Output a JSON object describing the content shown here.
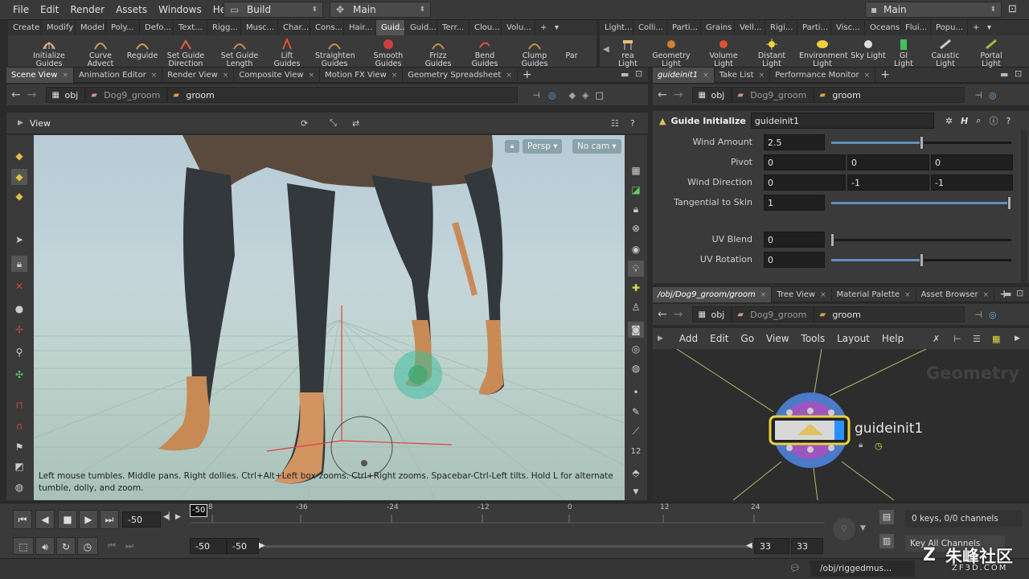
{
  "menubar": {
    "items": [
      "File",
      "Edit",
      "Render",
      "Assets",
      "Windows",
      "Help"
    ],
    "desktop_dropdown": "Build",
    "network_dropdown": "Main",
    "right_dropdown": "Main"
  },
  "shelf_left": {
    "tabs": [
      "Create",
      "Modify",
      "Model",
      "Poly...",
      "Defo...",
      "Text...",
      "Rigg...",
      "Musc...",
      "Char...",
      "Cons...",
      "Hair...",
      "Guid...",
      "Guid...",
      "Terr...",
      "Clou...",
      "Volu..."
    ],
    "active_tab_index": 11,
    "tools": [
      "Initialize Guides",
      "Curve Advect",
      "Reguide",
      "Set Guide Direction",
      "Set Guide Length",
      "Lift Guides",
      "Straighten Guides",
      "Smooth Guides",
      "Frizz Guides",
      "Bend Guides",
      "Clump Guides",
      "Par"
    ]
  },
  "shelf_right": {
    "tabs": [
      "Light...",
      "Colli...",
      "Parti...",
      "Grains",
      "Vell...",
      "Rigi...",
      "Parti...",
      "Visc...",
      "Oceans",
      "Flui...",
      "Popu..."
    ],
    "tools": [
      "rea Light",
      "Geometry Light",
      "Volume Light",
      "Distant Light",
      "Environment Light",
      "Sky Light",
      "GI Light",
      "Caustic Light",
      "Portal Light"
    ]
  },
  "left_pane": {
    "tabs": [
      "Scene View",
      "Animation Editor",
      "Render View",
      "Composite View",
      "Motion FX View",
      "Geometry Spreadsheet"
    ],
    "path": [
      "obj",
      "Dog9_groom",
      "groom"
    ],
    "view_label": "View",
    "persp": "Persp",
    "cam": "No cam",
    "help_text": "Left mouse tumbles. Middle pans. Right dollies. Ctrl+Alt+Left box-zooms. Ctrl+Right zooms. Spacebar-Ctrl-Left tilts. Hold L for alternate tumble, dolly, and zoom."
  },
  "param_pane": {
    "tabs": [
      "guideinit1",
      "Take List",
      "Performance Monitor"
    ],
    "path": [
      "obj",
      "Dog9_groom",
      "groom"
    ],
    "node_type": "Guide Initialize",
    "node_name": "guideinit1",
    "params": [
      {
        "label": "Wind Amount",
        "values": [
          "2.5"
        ],
        "slider": 0.5
      },
      {
        "label": "Pivot",
        "values": [
          "0",
          "0",
          "0"
        ]
      },
      {
        "label": "Wind Direction",
        "values": [
          "0",
          "-1",
          "-1"
        ]
      },
      {
        "label": "Tangential to Skin",
        "values": [
          "1"
        ],
        "slider": 1.0
      },
      {
        "label": "UV Blend",
        "values": [
          "0"
        ],
        "slider": 0.0
      },
      {
        "label": "UV Rotation",
        "values": [
          "0"
        ],
        "slider": 0.5
      }
    ]
  },
  "network_pane": {
    "tabs": [
      "/obj/Dog9_groom/groom",
      "Tree View",
      "Material Palette",
      "Asset Browser"
    ],
    "path": [
      "obj",
      "Dog9_groom",
      "groom"
    ],
    "menu": [
      "Add",
      "Edit",
      "Go",
      "View",
      "Tools",
      "Layout",
      "Help"
    ],
    "context_label": "Geometry",
    "node_name": "guideinit1"
  },
  "timeline": {
    "current_frame": "-50",
    "ticks": [
      "8",
      "-36",
      "-24",
      "-12",
      "0",
      "12",
      "24"
    ],
    "marker": "-50",
    "range_start": "-50",
    "range_start2": "-50",
    "range_end": "33",
    "range_end2": "33",
    "keys_info": "0 keys, 0/0 channels",
    "key_all": "Key All Channels",
    "status_path": "/obj/riggedmus..."
  },
  "watermark": {
    "text": "朱峰社区",
    "sub": "ZF3D.COM"
  }
}
